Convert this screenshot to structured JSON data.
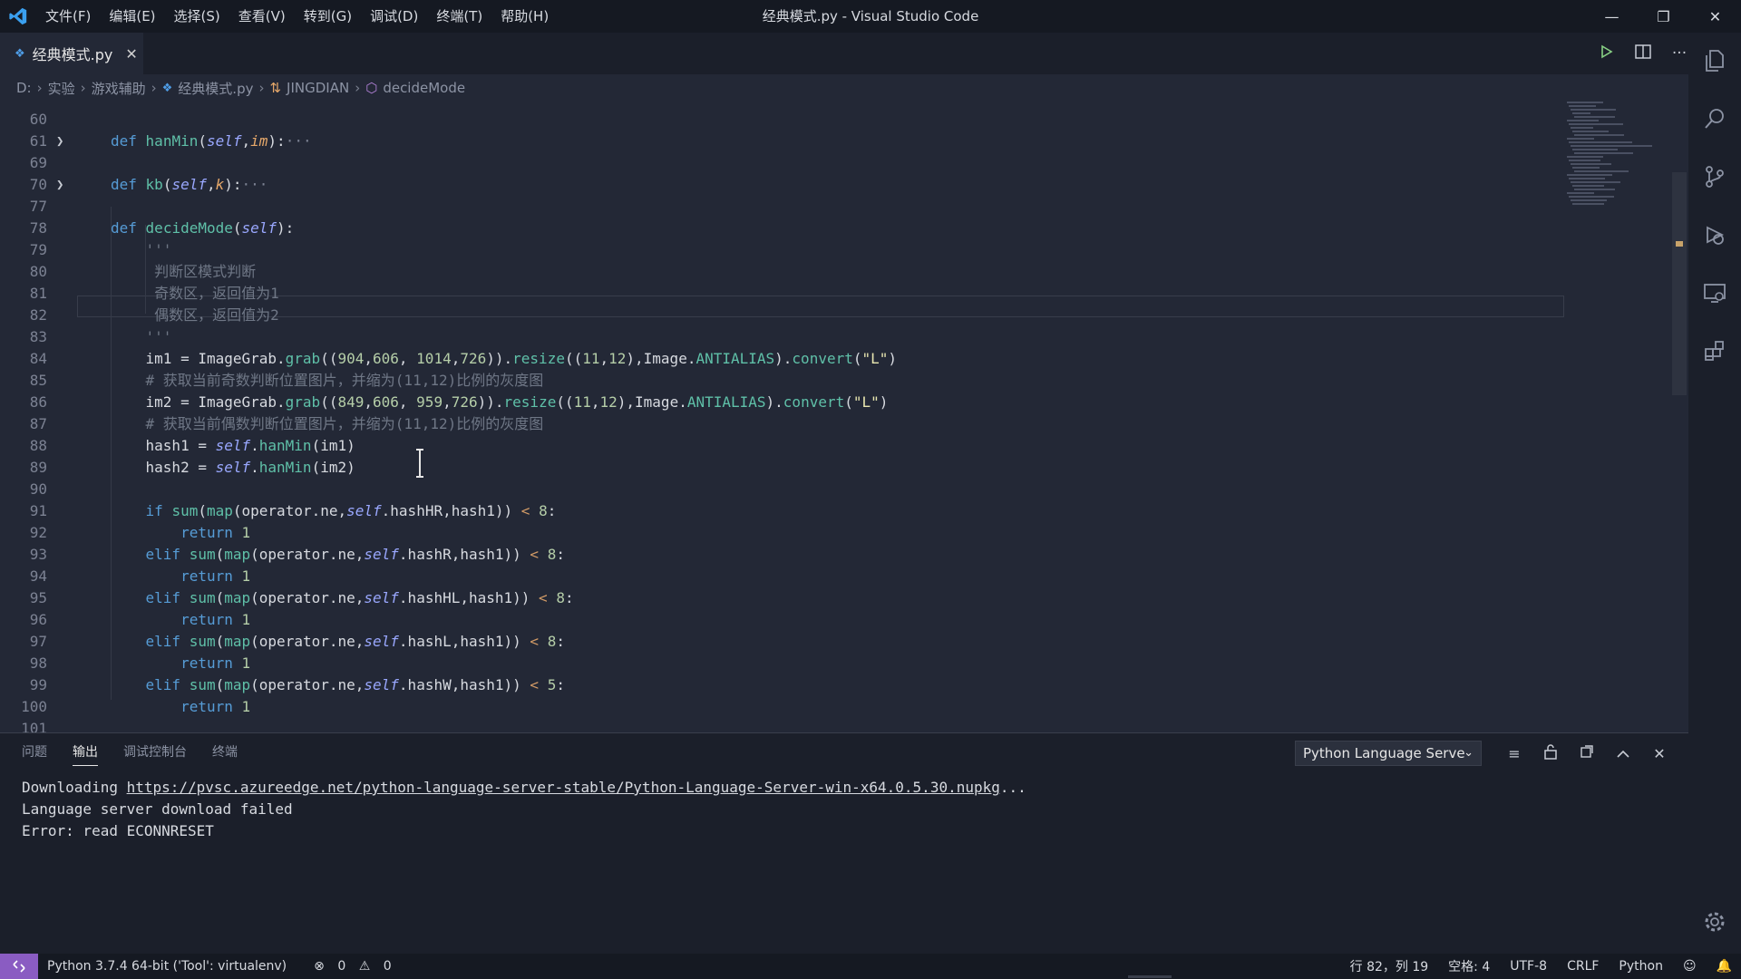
{
  "window": {
    "title": "经典模式.py - Visual Studio Code",
    "menu": [
      "文件(F)",
      "编辑(E)",
      "选择(S)",
      "查看(V)",
      "转到(G)",
      "调试(D)",
      "终端(T)",
      "帮助(H)"
    ]
  },
  "tab": {
    "label": "经典模式.py",
    "close": "✕"
  },
  "breadcrumb": [
    "D:",
    "实验",
    "游戏辅助",
    "经典模式.py",
    "JINGDIAN",
    "decideMode"
  ],
  "editor": {
    "lines": [
      {
        "n": "60",
        "html": ""
      },
      {
        "n": "61",
        "fold": true,
        "html": "<span class='kw'>def</span> <span class='fn'>hanMin</span><span class='plain'>(</span><span class='self'>self</span><span class='plain'>,</span><span class='param'>im</span><span class='plain'>):</span><span class='ell'>···</span>"
      },
      {
        "n": "69",
        "html": ""
      },
      {
        "n": "70",
        "fold": true,
        "html": "<span class='kw'>def</span> <span class='fn'>kb</span><span class='plain'>(</span><span class='self'>self</span><span class='plain'>,</span><span class='param'>k</span><span class='plain'>):</span><span class='ell'>···</span>"
      },
      {
        "n": "77",
        "html": ""
      },
      {
        "n": "78",
        "html": "<span class='kw'>def</span> <span class='fn'>decideMode</span><span class='plain'>(</span><span class='self'>self</span><span class='plain'>):</span>"
      },
      {
        "n": "79",
        "html": "    <span class='doc'>'''</span>"
      },
      {
        "n": "80",
        "html": "     <span class='doc'>判断区模式判断</span>"
      },
      {
        "n": "81",
        "html": "     <span class='doc'>奇数区，返回值为1</span>"
      },
      {
        "n": "82",
        "html": "     <span class='doc'>偶数区，返回值为2</span>"
      },
      {
        "n": "83",
        "html": "    <span class='doc'>'''</span>"
      },
      {
        "n": "84",
        "html": "    <span class='plain'>im1 = ImageGrab.</span><span class='fn'>grab</span><span class='plain'>((</span><span class='num'>904</span><span class='plain'>,</span><span class='num'>606</span><span class='plain'>, </span><span class='num'>1014</span><span class='plain'>,</span><span class='num'>726</span><span class='plain'>)).</span><span class='fn'>resize</span><span class='plain'>((</span><span class='num'>11</span><span class='plain'>,</span><span class='num'>12</span><span class='plain'>),Image.</span><span class='fn'>ANTIALIAS</span><span class='plain'>).</span><span class='fn'>convert</span><span class='plain'>(</span><span class='str'>\"L\"</span><span class='plain'>)</span>"
      },
      {
        "n": "85",
        "html": "    <span class='cmt'># 获取当前奇数判断位置图片，并缩为(11,12)比例的灰度图</span>"
      },
      {
        "n": "86",
        "html": "    <span class='plain'>im2 = ImageGrab.</span><span class='fn'>grab</span><span class='plain'>((</span><span class='num'>849</span><span class='plain'>,</span><span class='num'>606</span><span class='plain'>, </span><span class='num'>959</span><span class='plain'>,</span><span class='num'>726</span><span class='plain'>)).</span><span class='fn'>resize</span><span class='plain'>((</span><span class='num'>11</span><span class='plain'>,</span><span class='num'>12</span><span class='plain'>),Image.</span><span class='fn'>ANTIALIAS</span><span class='plain'>).</span><span class='fn'>convert</span><span class='plain'>(</span><span class='str'>\"L\"</span><span class='plain'>)</span>"
      },
      {
        "n": "87",
        "html": "    <span class='cmt'># 获取当前偶数判断位置图片，并缩为(11,12)比例的灰度图</span>"
      },
      {
        "n": "88",
        "html": "    <span class='plain'>hash1 = </span><span class='self'>self</span><span class='plain'>.</span><span class='fn'>hanMin</span><span class='plain'>(im1)</span>"
      },
      {
        "n": "89",
        "html": "    <span class='plain'>hash2 = </span><span class='self'>self</span><span class='plain'>.</span><span class='fn'>hanMin</span><span class='plain'>(im2)</span>"
      },
      {
        "n": "90",
        "html": ""
      },
      {
        "n": "91",
        "html": "    <span class='kw'>if</span> <span class='fn'>sum</span><span class='plain'>(</span><span class='fn'>map</span><span class='plain'>(operator.ne,</span><span class='self'>self</span><span class='plain'>.hashHR,hash1)) </span><span class='op'>&lt;</span> <span class='num'>8</span><span class='plain'>:</span>"
      },
      {
        "n": "92",
        "html": "        <span class='kw'>return</span> <span class='num'>1</span>"
      },
      {
        "n": "93",
        "html": "    <span class='kw'>elif</span> <span class='fn'>sum</span><span class='plain'>(</span><span class='fn'>map</span><span class='plain'>(operator.ne,</span><span class='self'>self</span><span class='plain'>.hashR,hash1)) </span><span class='op'>&lt;</span> <span class='num'>8</span><span class='plain'>:</span>"
      },
      {
        "n": "94",
        "html": "        <span class='kw'>return</span> <span class='num'>1</span>"
      },
      {
        "n": "95",
        "html": "    <span class='kw'>elif</span> <span class='fn'>sum</span><span class='plain'>(</span><span class='fn'>map</span><span class='plain'>(operator.ne,</span><span class='self'>self</span><span class='plain'>.hashHL,hash1)) </span><span class='op'>&lt;</span> <span class='num'>8</span><span class='plain'>:</span>"
      },
      {
        "n": "96",
        "html": "        <span class='kw'>return</span> <span class='num'>1</span>"
      },
      {
        "n": "97",
        "html": "    <span class='kw'>elif</span> <span class='fn'>sum</span><span class='plain'>(</span><span class='fn'>map</span><span class='plain'>(operator.ne,</span><span class='self'>self</span><span class='plain'>.hashL,hash1)) </span><span class='op'>&lt;</span> <span class='num'>8</span><span class='plain'>:</span>"
      },
      {
        "n": "98",
        "html": "        <span class='kw'>return</span> <span class='num'>1</span>"
      },
      {
        "n": "99",
        "html": "    <span class='kw'>elif</span> <span class='fn'>sum</span><span class='plain'>(</span><span class='fn'>map</span><span class='plain'>(operator.ne,</span><span class='self'>self</span><span class='plain'>.hashW,hash1)) </span><span class='op'>&lt;</span> <span class='num'>5</span><span class='plain'>:</span>"
      },
      {
        "n": "100",
        "html": "        <span class='kw'>return</span> <span class='num'>1</span>"
      },
      {
        "n": "101",
        "html": ""
      }
    ]
  },
  "panel": {
    "tabs": [
      "问题",
      "输出",
      "调试控制台",
      "终端"
    ],
    "active_tab": "输出",
    "channel": "Python Language Serve",
    "output_prefix": "Downloading ",
    "output_link": "https://pvsc.azureedge.net/python-language-server-stable/Python-Language-Server-win-x64.0.5.30.nupkg",
    "output_suffix": "...",
    "output_line2": "Language server download failed",
    "output_line3": "Error: read ECONNRESET"
  },
  "status": {
    "interpreter": "Python 3.7.4 64-bit ('Tool': virtualenv)",
    "errors": "0",
    "warnings": "0",
    "position": "行 82，列 19",
    "spaces": "空格: 4",
    "encoding": "UTF-8",
    "eol": "CRLF",
    "language": "Python"
  },
  "colors": {
    "editor_bg": "#232836",
    "remote_badge": "#8a5cc2",
    "keyword": "#569cd6",
    "function": "#5fc0a8"
  }
}
